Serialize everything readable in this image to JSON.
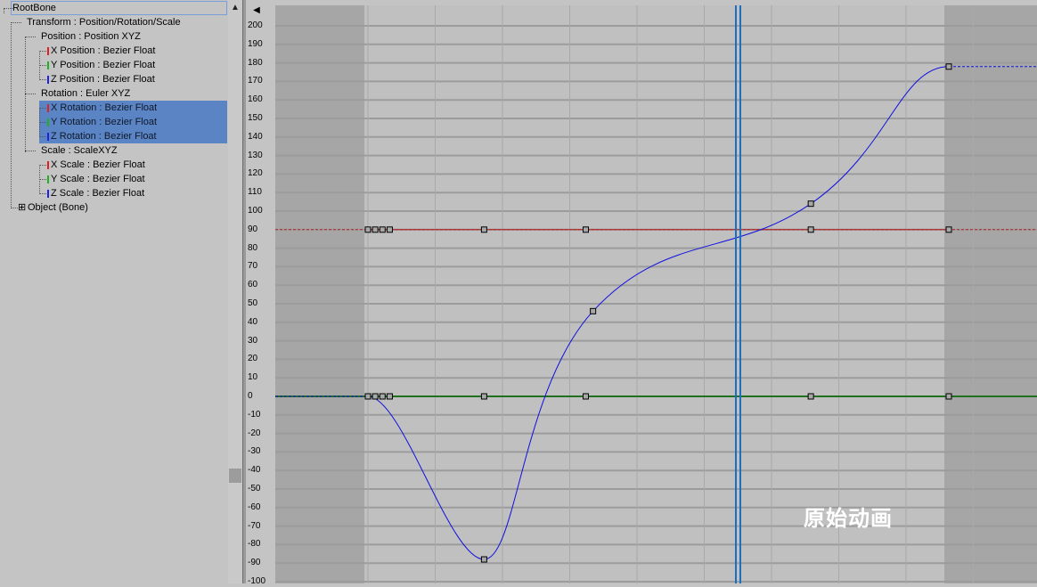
{
  "tree": {
    "items": [
      {
        "label": "RootBone",
        "depth": 0,
        "selected": false,
        "marker": ""
      },
      {
        "label": "Transform : Position/Rotation/Scale",
        "depth": 1,
        "selected": false,
        "marker": ""
      },
      {
        "label": "Position : Position XYZ",
        "depth": 2,
        "selected": false,
        "marker": ""
      },
      {
        "label": "X Position : Bezier Float",
        "depth": 3,
        "selected": false,
        "marker": "#e02020"
      },
      {
        "label": "Y Position : Bezier Float",
        "depth": 3,
        "selected": false,
        "marker": "#20b020"
      },
      {
        "label": "Z Position : Bezier Float",
        "depth": 3,
        "selected": false,
        "marker": "#2020e0"
      },
      {
        "label": "Rotation : Euler XYZ",
        "depth": 2,
        "selected": false,
        "marker": ""
      },
      {
        "label": "X Rotation : Bezier Float",
        "depth": 3,
        "selected": true,
        "marker": "#e02020"
      },
      {
        "label": "Y Rotation : Bezier Float",
        "depth": 3,
        "selected": true,
        "marker": "#20b020"
      },
      {
        "label": "Z Rotation : Bezier Float",
        "depth": 3,
        "selected": true,
        "marker": "#2020e0"
      },
      {
        "label": "Scale : ScaleXYZ",
        "depth": 2,
        "selected": false,
        "marker": ""
      },
      {
        "label": "X Scale : Bezier Float",
        "depth": 3,
        "selected": false,
        "marker": "#e02020"
      },
      {
        "label": "Y Scale : Bezier Float",
        "depth": 3,
        "selected": false,
        "marker": "#20b020"
      },
      {
        "label": "Z Scale : Bezier Float",
        "depth": 3,
        "selected": false,
        "marker": "#2020e0"
      },
      {
        "label": "Object (Bone)",
        "depth": 1,
        "selected": false,
        "marker": "",
        "expander": "⊞"
      }
    ]
  },
  "ruler": {
    "ticks": [
      "200",
      "190",
      "180",
      "170",
      "160",
      "150",
      "140",
      "130",
      "120",
      "110",
      "100",
      "90",
      "80",
      "70",
      "60",
      "50",
      "40",
      "30",
      "20",
      "10",
      "0",
      "-10",
      "-20",
      "-30",
      "-40",
      "-50",
      "-60",
      "-70",
      "-80",
      "-90",
      "-100"
    ]
  },
  "graph": {
    "value_range": [
      -100,
      200
    ],
    "colors": {
      "x_curve": "#b02020",
      "y_curve": "#207020",
      "z_curve": "#1010e0",
      "time_slider": "#1a6fc0",
      "key_fill": "#a8a8a8",
      "out_of_range": "#a6a6a6",
      "grid": "#9c9c9c"
    },
    "x_rotation_value": 90,
    "y_rotation_value": 0,
    "x_rotation_keys_frames": [
      0,
      2,
      4,
      6,
      32,
      60,
      122,
      160
    ],
    "y_rotation_keys_frames": [
      0,
      2,
      4,
      6,
      32,
      60,
      122,
      160
    ],
    "z_rotation_keys": [
      {
        "frame": 0,
        "value": 0
      },
      {
        "frame": 32,
        "value": -88
      },
      {
        "frame": 62,
        "value": 46
      },
      {
        "frame": 122,
        "value": 104
      },
      {
        "frame": 160,
        "value": 178
      }
    ]
  },
  "buttons": {
    "collapse_glyph": "◀",
    "scroll_up_glyph": "▲"
  },
  "watermark": "原始动画"
}
